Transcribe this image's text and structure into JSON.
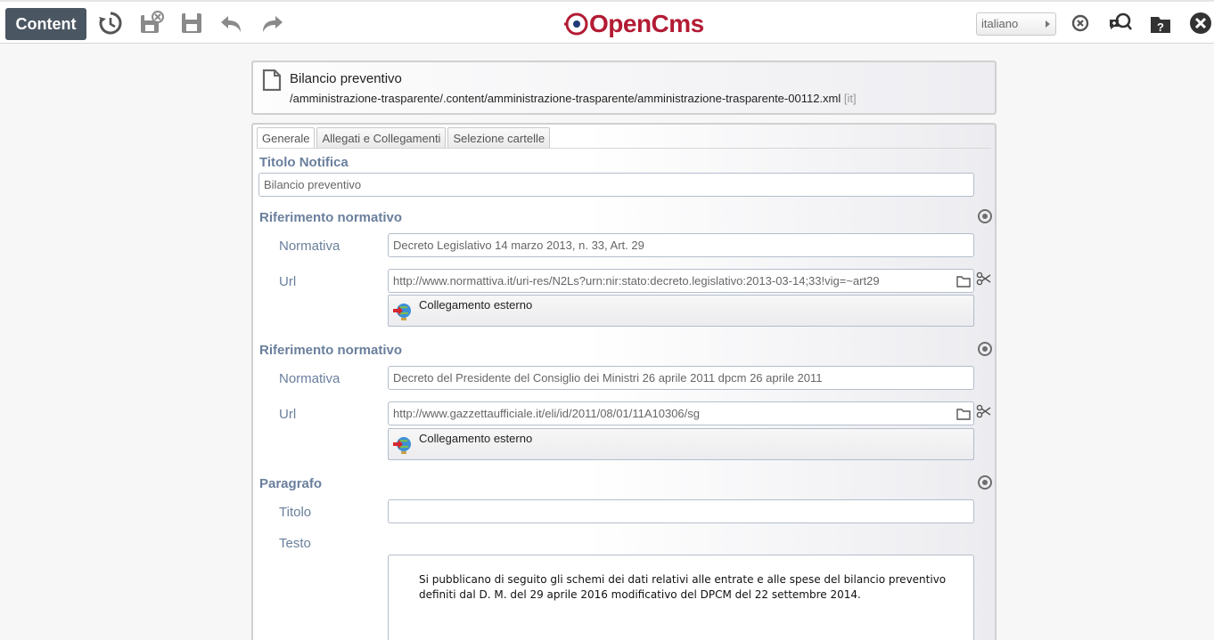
{
  "toolbar": {
    "content_label": "Content",
    "logo_text": "OpenCms",
    "language": "italiano",
    "icons": [
      "history-icon",
      "save-exit-icon",
      "save-icon",
      "undo-icon",
      "redo-icon",
      "clear-icon",
      "help-comment-icon",
      "help-icon",
      "close-icon"
    ]
  },
  "header": {
    "title": "Bilancio preventivo",
    "path": "/amministrazione-trasparente/.content/amministrazione-trasparente/amministrazione-trasparente-00112.xml",
    "locale": "[it]"
  },
  "tabs": [
    "Generale",
    "Allegati e Collegamenti",
    "Selezione cartelle"
  ],
  "form": {
    "titolo_label": "Titolo Notifica",
    "titolo_value": "Bilancio preventivo",
    "riferimenti": [
      {
        "label": "Riferimento normativo",
        "normativa_label": "Normativa",
        "normativa_value": "Decreto Legislativo 14 marzo 2013, n. 33, Art. 29",
        "url_label": "Url",
        "url_value": "http://www.normattiva.it/uri-res/N2Ls?urn:nir:stato:decreto.legislativo:2013-03-14;33!vig=~art29",
        "link_type": "Collegamento esterno"
      },
      {
        "label": "Riferimento normativo",
        "normativa_label": "Normativa",
        "normativa_value": "Decreto del Presidente del Consiglio dei Ministri 26 aprile 2011 dpcm 26 aprile 2011",
        "url_label": "Url",
        "url_value": "http://www.gazzettaufficiale.it/eli/id/2011/08/01/11A10306/sg",
        "link_type": "Collegamento esterno"
      }
    ],
    "paragrafo": {
      "label": "Paragrafo",
      "titolo_label": "Titolo",
      "titolo_value": "",
      "testo_label": "Testo",
      "testo_value": "Si pubblicano di seguito gli schemi dei dati relativi alle entrate e alle spese del bilancio preventivo definiti dal D. M. del 29 aprile 2016 modificativo del DPCM del 22 settembre 2014."
    }
  },
  "colors": {
    "label": "#6a7f9d",
    "content_button": "#4a5662",
    "logo": "#b31b34"
  }
}
